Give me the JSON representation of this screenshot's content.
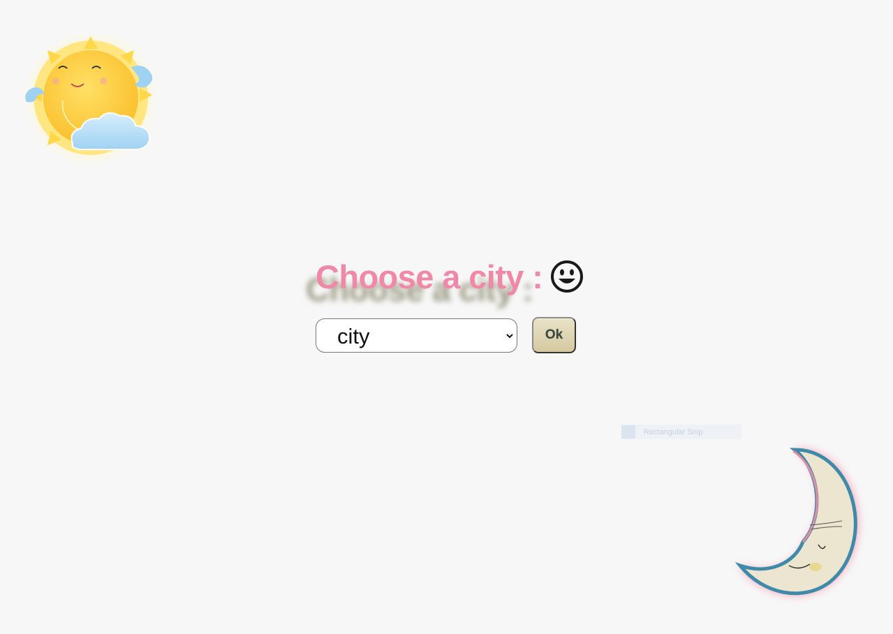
{
  "header": {
    "title": "Choose a city :",
    "emoji_icon": "smiley-face-icon"
  },
  "form": {
    "city_select": {
      "selected_value": "city",
      "options": [
        "city"
      ]
    },
    "ok_button_label": "Ok"
  },
  "decorations": {
    "sun_icon": "smiling-sun-with-cloud-icon",
    "moon_icon": "smiling-crescent-moon-icon"
  },
  "overlay": {
    "faint_label": "Rectangular Snip"
  },
  "colors": {
    "background": "#f7f7f7",
    "heading": "#f089a8",
    "button": "#ddd4b3"
  }
}
